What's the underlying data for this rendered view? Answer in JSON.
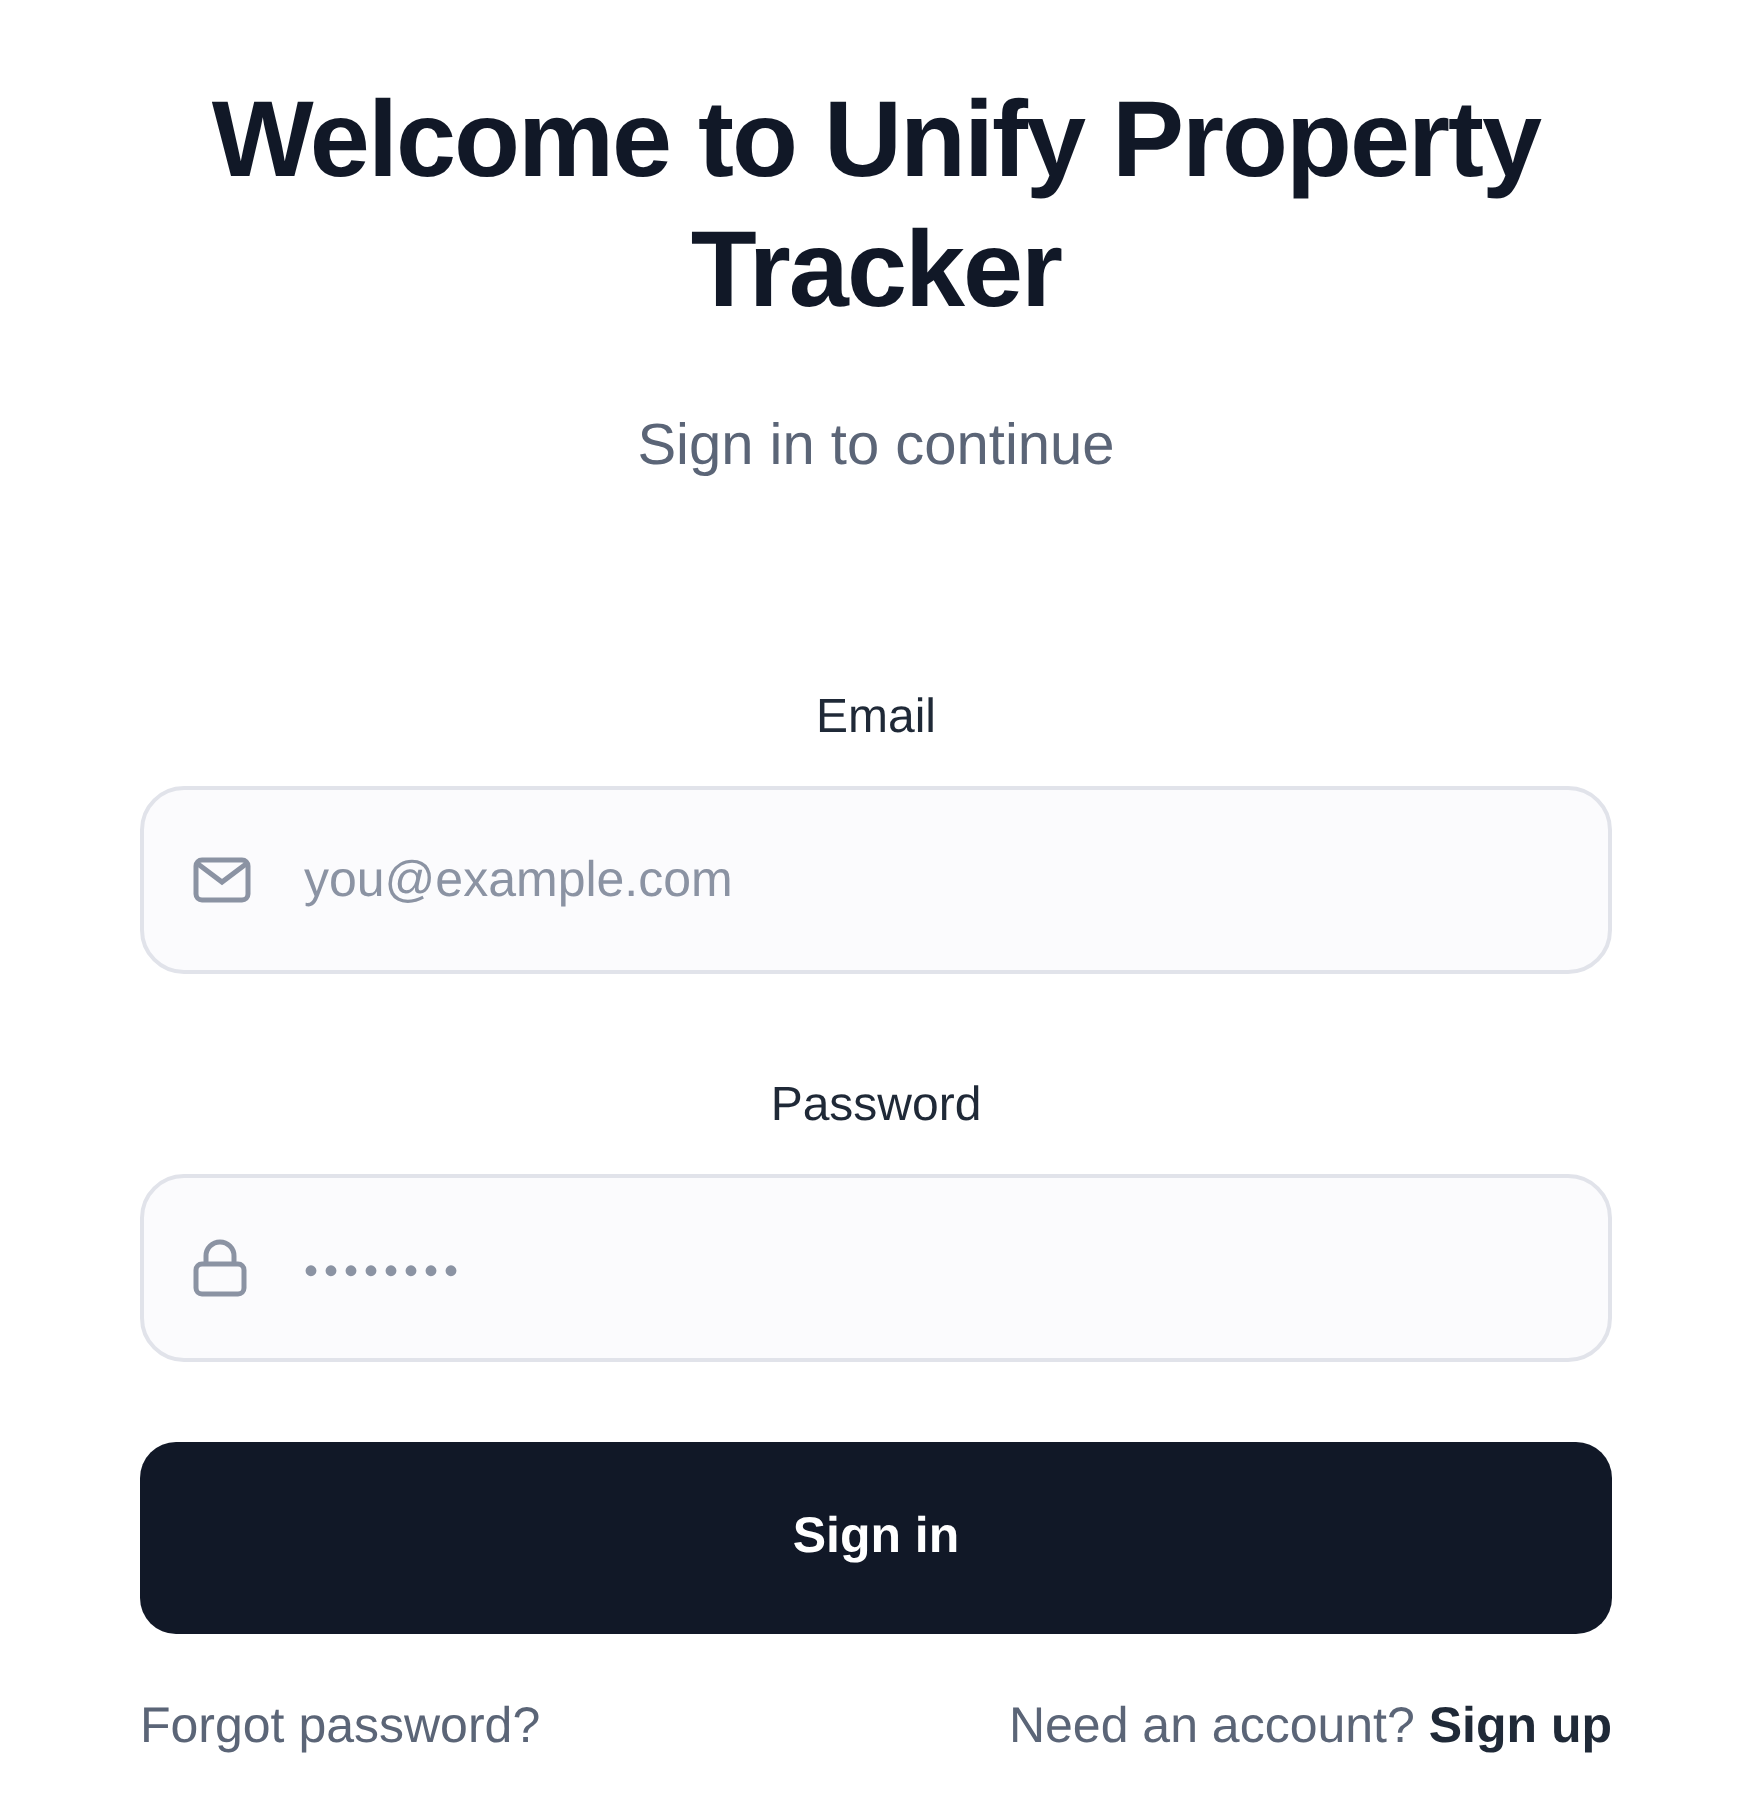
{
  "title": "Welcome to Unify Property Tracker",
  "subtitle": "Sign in to continue",
  "fields": [
    {
      "label": "Email",
      "kind": "email",
      "placeholder": "you@example.com"
    },
    {
      "label": "Password",
      "kind": "password",
      "placeholder": "••••••••"
    }
  ],
  "submit_button": "Sign in",
  "forgot_link": "Forgot password?",
  "signup_prompt": {
    "text": "Need an account?",
    "link": "Sign up"
  }
}
